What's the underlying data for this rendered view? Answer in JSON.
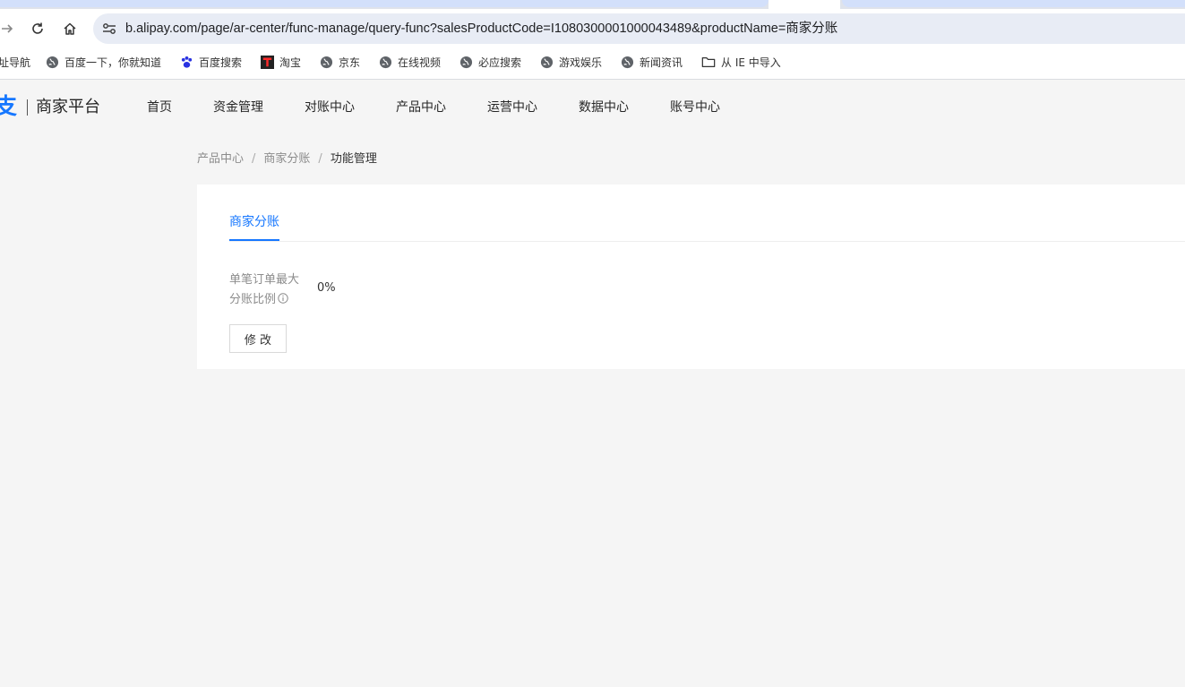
{
  "browser": {
    "url": "b.alipay.com/page/ar-center/func-manage/query-func?salesProductCode=I1080300001000043489&productName=商家分账",
    "bookmarks": [
      {
        "label": "址导航"
      },
      {
        "label": "百度一下，你就知道"
      },
      {
        "label": "百度搜索"
      },
      {
        "label": "淘宝"
      },
      {
        "label": "京东"
      },
      {
        "label": "在线视频"
      },
      {
        "label": "必应搜索"
      },
      {
        "label": "游戏娱乐"
      },
      {
        "label": "新闻资讯"
      },
      {
        "label": "从 IE 中导入"
      }
    ]
  },
  "header": {
    "logo_mark": "支",
    "logo_text": "商家平台",
    "nav": [
      {
        "label": "首页"
      },
      {
        "label": "资金管理"
      },
      {
        "label": "对账中心"
      },
      {
        "label": "产品中心"
      },
      {
        "label": "运营中心"
      },
      {
        "label": "数据中心"
      },
      {
        "label": "账号中心"
      }
    ]
  },
  "breadcrumb": {
    "items": [
      "产品中心",
      "商家分账"
    ],
    "separator": "/",
    "current": "功能管理"
  },
  "main": {
    "tab_label": "商家分账",
    "field_label_line1": "单笔订单最大",
    "field_label_line2": "分账比例",
    "field_value": "0%",
    "edit_button": "修 改"
  },
  "colors": {
    "accent": "#1677ff",
    "page_bg": "#f5f5f5"
  }
}
